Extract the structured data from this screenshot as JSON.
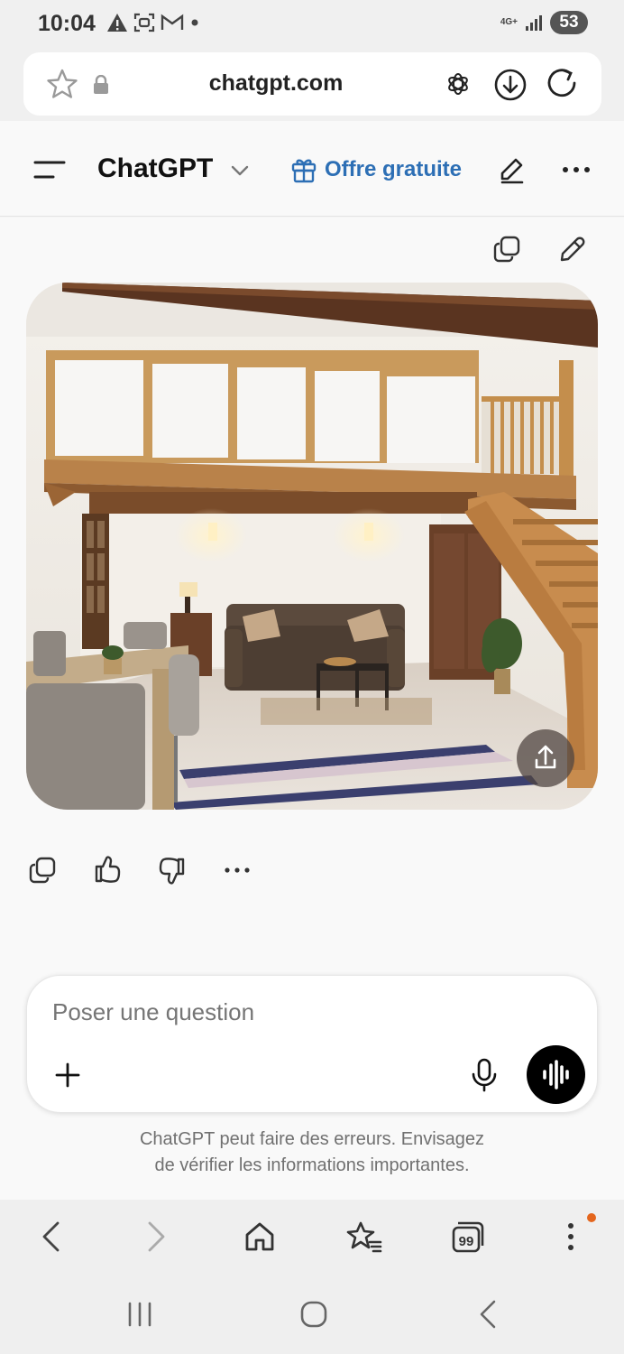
{
  "status_bar": {
    "time": "10:04",
    "network": "4G+",
    "battery": "53",
    "icons": [
      "warning-icon",
      "screenshot-icon",
      "gmail-icon",
      "dot-icon",
      "signal-icon"
    ]
  },
  "browser": {
    "url": "chatgpt.com",
    "icons": [
      "star-icon",
      "lock-icon",
      "openai-icon",
      "download-icon",
      "reload-icon"
    ]
  },
  "header": {
    "title": "ChatGPT",
    "offer_label": "Offre gratuite",
    "icons": [
      "menu-icon",
      "chevron-down-icon",
      "gift-icon",
      "new-chat-icon",
      "more-icon"
    ]
  },
  "message": {
    "image_description_icon": "generated-image",
    "actions": [
      "copy-icon",
      "thumbs-up-icon",
      "thumbs-down-icon",
      "more-icon"
    ]
  },
  "composer": {
    "placeholder": "Poser une question",
    "icons": [
      "plus-icon",
      "mic-icon",
      "voice-mode-icon"
    ]
  },
  "disclaimer": {
    "line1": "ChatGPT peut faire des erreurs. Envisagez",
    "line2": "de vérifier les informations importantes."
  },
  "browser_nav": {
    "tabs_count": "99",
    "icons": [
      "back-icon",
      "forward-icon",
      "home-icon",
      "bookmarks-icon",
      "tabs-icon",
      "menu-kebab-icon"
    ]
  },
  "colors": {
    "accent": "#2d6fb5",
    "badge": "#e4661e",
    "background": "#f9f9f9"
  }
}
